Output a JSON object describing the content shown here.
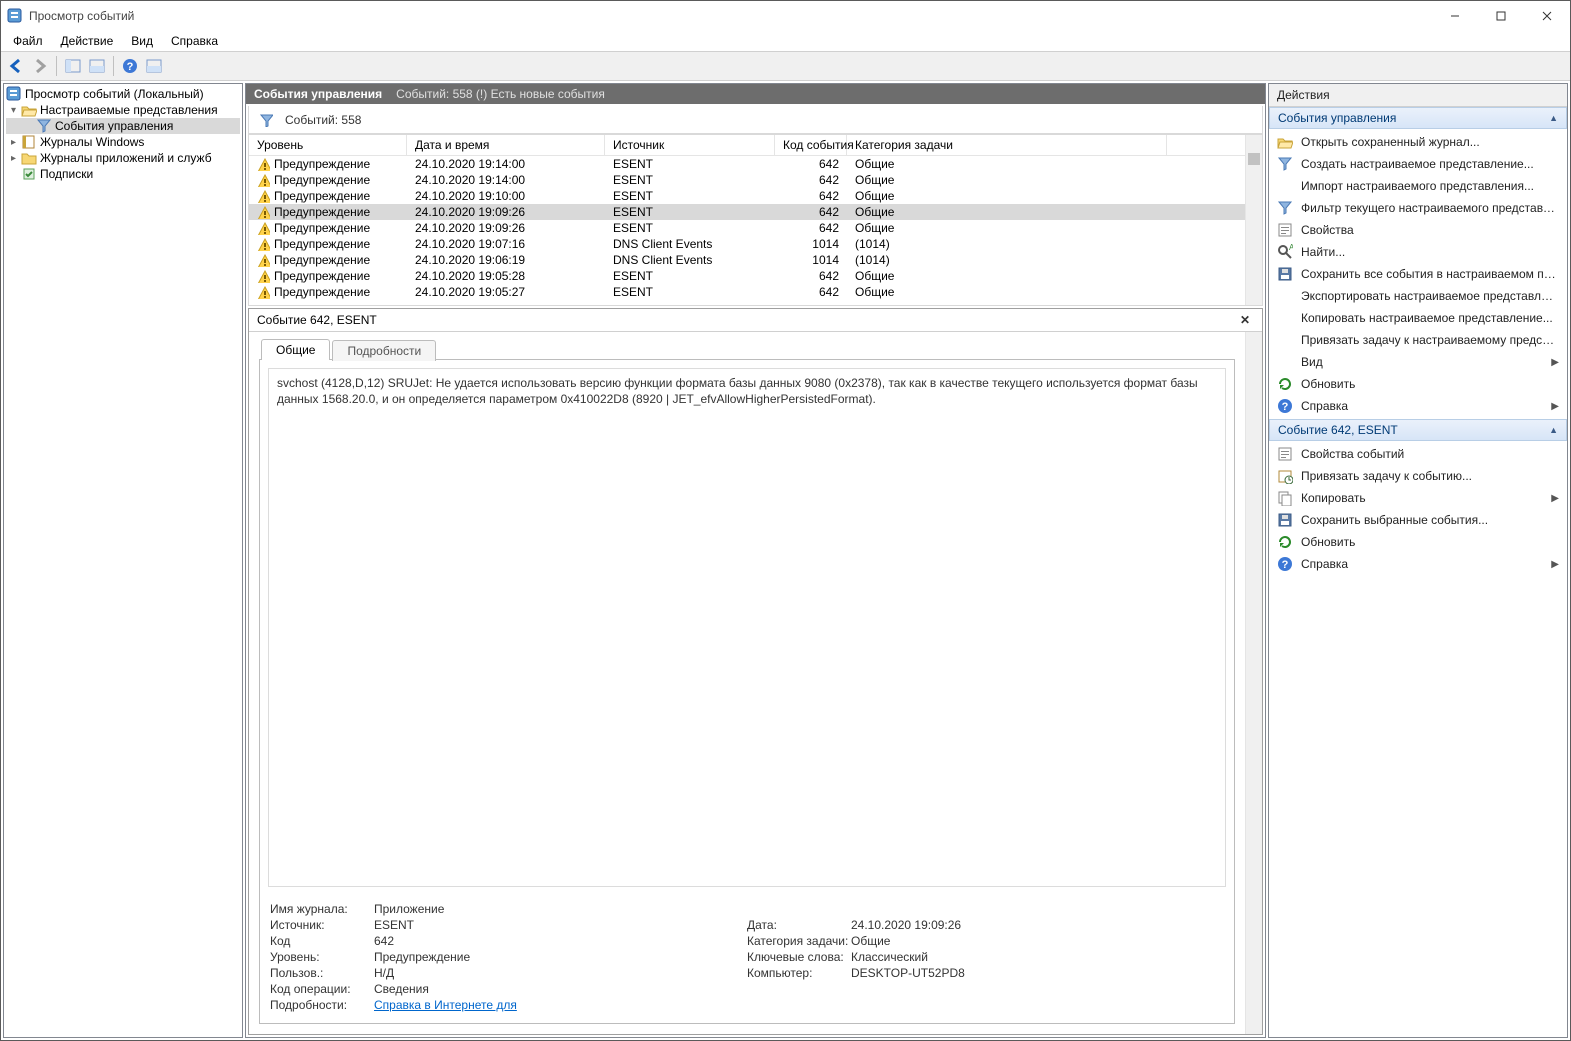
{
  "title": "Просмотр событий",
  "menus": {
    "file": "Файл",
    "action": "Действие",
    "view": "Вид",
    "help": "Справка"
  },
  "tree": {
    "root": "Просмотр событий (Локальный)",
    "custom_views": "Настраиваемые представления",
    "admin_events": "События управления",
    "win_logs": "Журналы Windows",
    "app_logs": "Журналы приложений и служб",
    "subs": "Подписки"
  },
  "center": {
    "header_title": "События управления",
    "header_info": "Событий: 558 (!) Есть новые события",
    "filter_label": "Событий: 558",
    "columns": {
      "level": "Уровень",
      "datetime": "Дата и время",
      "source": "Источник",
      "code": "Код события",
      "task": "Категория задачи"
    },
    "warn_label": "Предупреждение",
    "rows": [
      {
        "dt": "24.10.2020 19:14:00",
        "src": "ESENT",
        "code": "642",
        "task": "Общие"
      },
      {
        "dt": "24.10.2020 19:14:00",
        "src": "ESENT",
        "code": "642",
        "task": "Общие"
      },
      {
        "dt": "24.10.2020 19:10:00",
        "src": "ESENT",
        "code": "642",
        "task": "Общие"
      },
      {
        "dt": "24.10.2020 19:09:26",
        "src": "ESENT",
        "code": "642",
        "task": "Общие",
        "selected": true
      },
      {
        "dt": "24.10.2020 19:09:26",
        "src": "ESENT",
        "code": "642",
        "task": "Общие"
      },
      {
        "dt": "24.10.2020 19:07:16",
        "src": "DNS Client Events",
        "code": "1014",
        "task": "(1014)"
      },
      {
        "dt": "24.10.2020 19:06:19",
        "src": "DNS Client Events",
        "code": "1014",
        "task": "(1014)"
      },
      {
        "dt": "24.10.2020 19:05:28",
        "src": "ESENT",
        "code": "642",
        "task": "Общие"
      },
      {
        "dt": "24.10.2020 19:05:27",
        "src": "ESENT",
        "code": "642",
        "task": "Общие"
      }
    ]
  },
  "preview": {
    "title": "Событие 642, ESENT",
    "tab_general": "Общие",
    "tab_details": "Подробности",
    "message": "svchost (4128,D,12) SRUJet: Не удается использовать версию функции формата базы данных 9080 (0x2378), так как в качестве текущего используется формат базы данных 1568.20.0, и он определяется параметром 0x410022D8 (8920 | JET_efvAllowHigherPersistedFormat).",
    "meta": {
      "log_name_label": "Имя журнала:",
      "log_name": "Приложение",
      "source_label": "Источник:",
      "source": "ESENT",
      "date_label": "Дата:",
      "date": "24.10.2020 19:09:26",
      "code_label": "Код",
      "code": "642",
      "task_label": "Категория задачи:",
      "task": "Общие",
      "level_label": "Уровень:",
      "level": "Предупреждение",
      "keywords_label": "Ключевые слова:",
      "keywords": "Классический",
      "user_label": "Пользов.:",
      "user": "Н/Д",
      "computer_label": "Компьютер:",
      "computer": "DESKTOP-UT52PD8",
      "opcode_label": "Код операции:",
      "opcode": "Сведения",
      "details_label": "Подробности:",
      "details_link": "Справка в Интернете для"
    }
  },
  "actions": {
    "title": "Действия",
    "group1_title": "События управления",
    "group1": [
      {
        "icon": "folder-open",
        "label": "Открыть сохраненный журнал..."
      },
      {
        "icon": "funnel-new",
        "label": "Создать настраиваемое представление..."
      },
      {
        "icon": "",
        "label": "Импорт настраиваемого представления..."
      },
      {
        "icon": "funnel",
        "label": "Фильтр текущего настраиваемого представления..."
      },
      {
        "icon": "props",
        "label": "Свойства"
      },
      {
        "icon": "find",
        "label": "Найти..."
      },
      {
        "icon": "save",
        "label": "Сохранить все события в настраиваемом представл..."
      },
      {
        "icon": "",
        "label": "Экспортировать настраиваемое представление..."
      },
      {
        "icon": "",
        "label": "Копировать настраиваемое представление..."
      },
      {
        "icon": "",
        "label": "Привязать задачу к настраиваемому представлени..."
      },
      {
        "icon": "",
        "label": "Вид",
        "submenu": true
      },
      {
        "icon": "refresh",
        "label": "Обновить"
      },
      {
        "icon": "help",
        "label": "Справка",
        "submenu": true
      }
    ],
    "group2_title": "Событие 642, ESENT",
    "group2": [
      {
        "icon": "props",
        "label": "Свойства событий"
      },
      {
        "icon": "attach-task",
        "label": "Привязать задачу к событию..."
      },
      {
        "icon": "copy",
        "label": "Копировать",
        "submenu": true
      },
      {
        "icon": "save",
        "label": "Сохранить выбранные события..."
      },
      {
        "icon": "refresh",
        "label": "Обновить"
      },
      {
        "icon": "help",
        "label": "Справка",
        "submenu": true
      }
    ]
  }
}
